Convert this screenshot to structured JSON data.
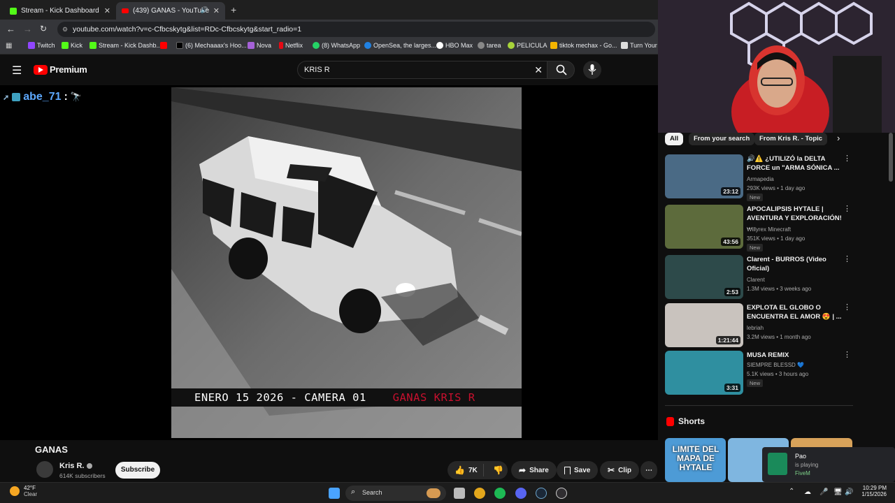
{
  "tabs": [
    {
      "title": "Stream - Kick Dashboard",
      "active": false
    },
    {
      "title": "(439) GANAS - YouTube",
      "active": true
    }
  ],
  "address": {
    "url": "youtube.com/watch?v=c-Cfbcskytg&list=RDc-Cfbcskytg&start_radio=1"
  },
  "bookmarks": [
    "Twitch",
    "Kick",
    "Stream - Kick Dashb...",
    "",
    "(6) Mechaaax's Hoo...",
    "Nova",
    "Netflix",
    "(8) WhatsApp",
    "OpenSea, the larges...",
    "HBO Max",
    "tarea",
    "PELICULA",
    "tiktok mechax - Go...",
    "Turn Your S"
  ],
  "youtube": {
    "logo": "Premium",
    "search_value": "KRIS R",
    "chat_overlay": {
      "user": "abe_71",
      "separator": ":"
    },
    "video_caption": {
      "left": "ENERO 15 2026 - CAMERA 01",
      "right": "GANAS KRIS R"
    },
    "video_title": "GANAS",
    "channel": {
      "name": "Kris R.",
      "subscribers": "614K subscribers",
      "subscribe_label": "Subscribe"
    },
    "actions": {
      "likes": "7K",
      "share": "Share",
      "save": "Save",
      "clip": "Clip"
    }
  },
  "sidebar": {
    "chips": [
      "All",
      "From your search",
      "From Kris R. - Topic"
    ],
    "recommendations": [
      {
        "title": "🔊⚠️ ¿UTILIZÓ la DELTA FORCE un \"ARMA SÓNICA ...",
        "channel": "Armapedia",
        "meta": "293K views • 1 day ago",
        "badge": "New",
        "duration": "23:12",
        "color": "#4a6a85"
      },
      {
        "title": "APOCALIPSIS HYTALE | AVENTURA Y EXPLORACIÓN! ...",
        "channel": "Willyrex Minecraft",
        "meta": "351K views • 1 day ago",
        "badge": "New",
        "duration": "43:56",
        "color": "#5d6b3c"
      },
      {
        "title": "Clarent - BURROS (Video Oficial)",
        "channel": "Clarent",
        "meta": "1.3M views • 3 weeks ago",
        "badge": "",
        "duration": "2:53",
        "color": "#2d4a4a"
      },
      {
        "title": "EXPLOTA EL GLOBO O ENCUENTRA EL AMOR 😍 | ...",
        "channel": "lebriah",
        "meta": "3.2M views • 1 month ago",
        "badge": "",
        "duration": "1:21:44",
        "color": "#c9c3be"
      },
      {
        "title": "MUSA REMIX",
        "channel": "SIEMPRE BLESSD 💙",
        "meta": "5.1K views • 3 hours ago",
        "badge": "New",
        "duration": "3:31",
        "color": "#2f8fa0"
      }
    ],
    "shorts_label": "Shorts",
    "shorts": [
      {
        "text": "LIMITE DEL MAPA DE HYTALE",
        "color": "#4d9bd6"
      },
      {
        "text": "",
        "color": "#7fb6e0"
      },
      {
        "text": "",
        "color": "#d7a25a"
      }
    ],
    "notification": {
      "name": "Pao",
      "status": "is playing",
      "game": "FiveM"
    }
  },
  "taskbar": {
    "weather_temp": "42°F",
    "weather_desc": "Clear",
    "search_label": "Search",
    "time": "10:29 PM",
    "date": "1/15/2026"
  }
}
